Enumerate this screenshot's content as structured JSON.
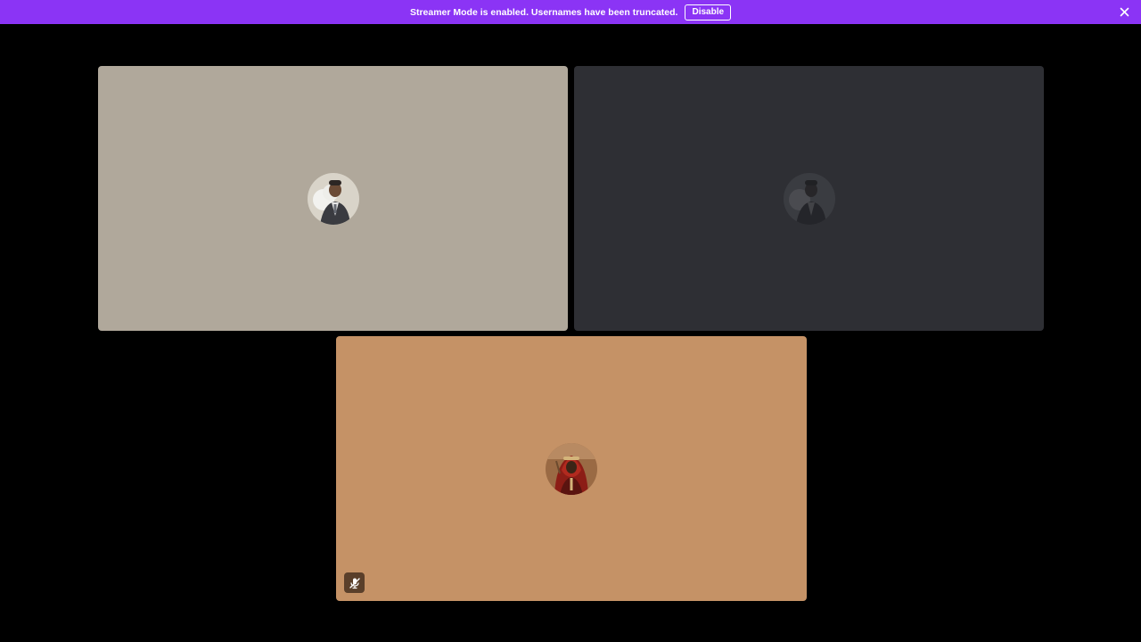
{
  "banner": {
    "message": "Streamer Mode is enabled. Usernames have been truncated.",
    "disable_label": "Disable",
    "close_icon": "close-icon",
    "color": "#8b34f5"
  },
  "participants": [
    {
      "id": "tile-1",
      "background": "#b0a89b",
      "avatar_icon": "avatar-photo",
      "muted": false
    },
    {
      "id": "tile-2",
      "background": "#2e2f34",
      "avatar_icon": "avatar-photo",
      "muted": false,
      "dimmed": true
    },
    {
      "id": "tile-3",
      "background": "#c59266",
      "avatar_icon": "avatar-photo",
      "muted": true,
      "mute_icon": "microphone-muted-icon"
    }
  ]
}
